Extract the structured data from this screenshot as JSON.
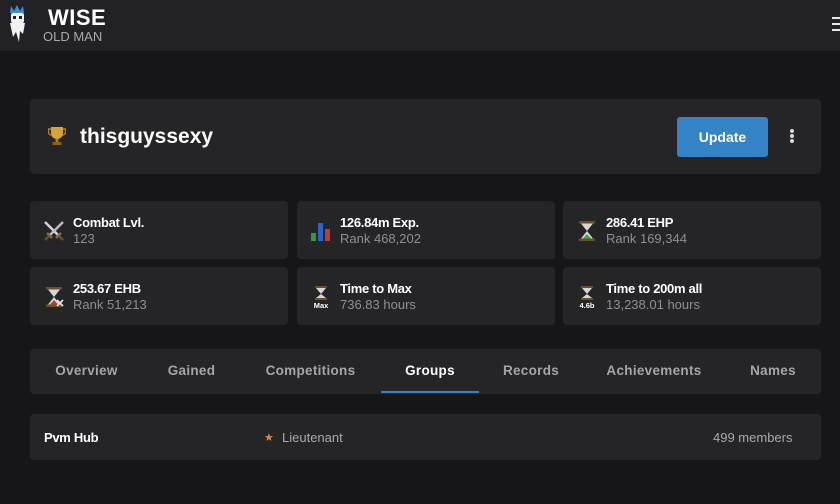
{
  "app": {
    "title": "WISE",
    "subtitle": "OLD MAN"
  },
  "player": {
    "name": "thisguyssexy",
    "update_label": "Update"
  },
  "stats": [
    {
      "title": "Combat Lvl.",
      "sub": "123",
      "icon": "swords-icon"
    },
    {
      "title": "126.84m Exp.",
      "sub": "Rank 468,202",
      "icon": "bar-chart-icon"
    },
    {
      "title": "286.41 EHP",
      "sub": "Rank 169,344",
      "icon": "hourglass-green-icon"
    },
    {
      "title": "253.67 EHB",
      "sub": "Rank 51,213",
      "icon": "hourglass-red-icon"
    },
    {
      "title": "Time to Max",
      "sub": "736.83 hours",
      "icon": "hourglass-max-icon",
      "badge": "Max"
    },
    {
      "title": "Time to 200m all",
      "sub": "13,238.01 hours",
      "icon": "hourglass-200m-icon",
      "badge": "4.6b"
    }
  ],
  "tabs": [
    {
      "label": "Overview",
      "active": false
    },
    {
      "label": "Gained",
      "active": false
    },
    {
      "label": "Competitions",
      "active": false
    },
    {
      "label": "Groups",
      "active": true
    },
    {
      "label": "Records",
      "active": false
    },
    {
      "label": "Achievements",
      "active": false
    },
    {
      "label": "Names",
      "active": false
    }
  ],
  "groups": [
    {
      "name": "Pvm Hub",
      "role": "Lieutenant",
      "members": "499 members"
    }
  ],
  "colors": {
    "accent": "#3583c7",
    "background": "#161618",
    "card": "#252528",
    "role_star": "#e3883a"
  }
}
